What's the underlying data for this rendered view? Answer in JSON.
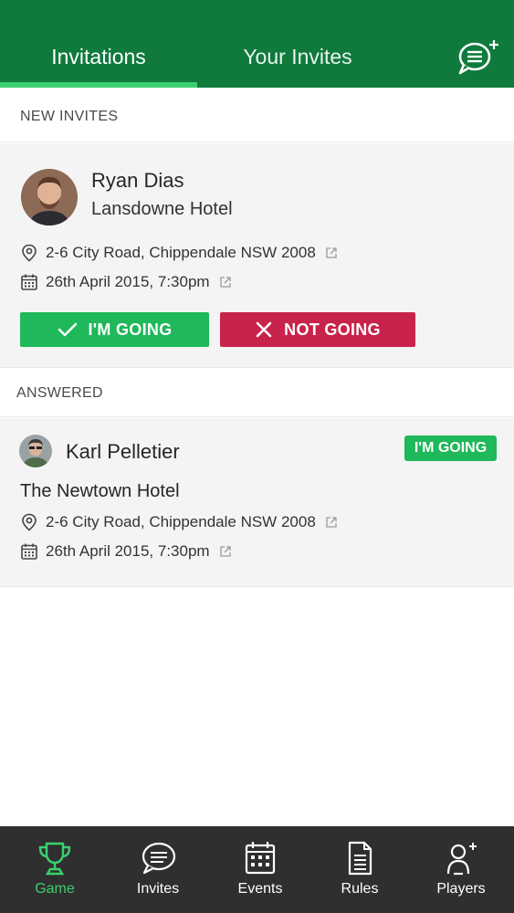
{
  "header": {
    "tabs": [
      {
        "label": "Invitations",
        "active": true
      },
      {
        "label": "Your Invites",
        "active": false
      }
    ],
    "new_chat_icon": "chat-plus-icon",
    "colors": {
      "background": "#0f7a3c",
      "indicator": "#3bd16f"
    }
  },
  "sections": {
    "new_invites": "NEW INVITES",
    "answered": "ANSWERED"
  },
  "invites_new": [
    {
      "name": "Ryan Dias",
      "venue": "Lansdowne Hotel",
      "address": "2-6 City Road, Chippendale NSW 2008",
      "datetime": "26th April 2015, 7:30pm",
      "actions": {
        "going": "I'M GOING",
        "not_going": "NOT GOING"
      }
    }
  ],
  "invites_answered": [
    {
      "name": "Karl Pelletier",
      "venue": "The Newtown Hotel",
      "address": "2-6 City Road, Chippendale NSW 2008",
      "datetime": "26th April 2015, 7:30pm",
      "status": "I'M GOING"
    }
  ],
  "bottom_nav": [
    {
      "label": "Game",
      "icon": "trophy-icon",
      "active": true
    },
    {
      "label": "Invites",
      "icon": "chat-icon",
      "active": false
    },
    {
      "label": "Events",
      "icon": "calendar-icon",
      "active": false
    },
    {
      "label": "Rules",
      "icon": "document-icon",
      "active": false
    },
    {
      "label": "Players",
      "icon": "add-person-icon",
      "active": false
    }
  ],
  "colors": {
    "going": "#1fb85a",
    "not_going": "#c8234b",
    "nav_bg": "#2f2f2f",
    "active_nav": "#3bd16f"
  }
}
